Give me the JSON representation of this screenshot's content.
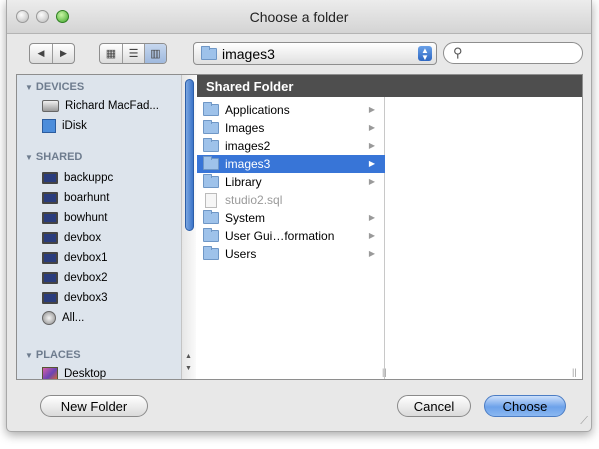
{
  "window": {
    "title": "Choose a folder"
  },
  "toolbar": {
    "back_glyph": "◀",
    "forward_glyph": "▶",
    "view_icon_glyph": "▦",
    "view_list_glyph": "☰",
    "view_column_glyph": "▥",
    "path_label": "images3",
    "search_placeholder": "",
    "search_glyph": "⚲"
  },
  "sidebar": {
    "devices_heading": "DEVICES",
    "shared_heading": "SHARED",
    "places_heading": "PLACES",
    "devices": [
      {
        "label": "Richard MacFad...",
        "icon": "hard-drive-icon"
      },
      {
        "label": "iDisk",
        "icon": "idisk-icon"
      }
    ],
    "shared": [
      {
        "label": "backuppc",
        "icon": "monitor-icon"
      },
      {
        "label": "boarhunt",
        "icon": "monitor-icon"
      },
      {
        "label": "bowhunt",
        "icon": "monitor-icon"
      },
      {
        "label": "devbox",
        "icon": "monitor-icon"
      },
      {
        "label": "devbox1",
        "icon": "monitor-icon"
      },
      {
        "label": "devbox2",
        "icon": "monitor-icon"
      },
      {
        "label": "devbox3",
        "icon": "monitor-icon"
      },
      {
        "label": "All...",
        "icon": "network-icon"
      }
    ],
    "places": [
      {
        "label": "Desktop",
        "icon": "desktop-icon"
      }
    ]
  },
  "browser": {
    "column_header": "Shared Folder",
    "items": [
      {
        "label": "Applications",
        "kind": "folder",
        "has_children": true,
        "selected": false
      },
      {
        "label": "Images",
        "kind": "folder",
        "has_children": true,
        "selected": false
      },
      {
        "label": "images2",
        "kind": "folder",
        "has_children": true,
        "selected": false
      },
      {
        "label": "images3",
        "kind": "folder",
        "has_children": true,
        "selected": true
      },
      {
        "label": "Library",
        "kind": "folder",
        "has_children": true,
        "selected": false
      },
      {
        "label": "studio2.sql",
        "kind": "file",
        "has_children": false,
        "selected": false
      },
      {
        "label": "System",
        "kind": "folder",
        "has_children": true,
        "selected": false
      },
      {
        "label": "User Gui…formation",
        "kind": "folder",
        "has_children": true,
        "selected": false
      },
      {
        "label": "Users",
        "kind": "folder",
        "has_children": true,
        "selected": false
      }
    ]
  },
  "footer": {
    "new_folder_label": "New Folder",
    "cancel_label": "Cancel",
    "choose_label": "Choose"
  },
  "colors": {
    "selection": "#3875d7",
    "header_bg": "#4e4e4e",
    "sidebar_bg": "#dde4ec",
    "default_button": "#6da2ea"
  }
}
